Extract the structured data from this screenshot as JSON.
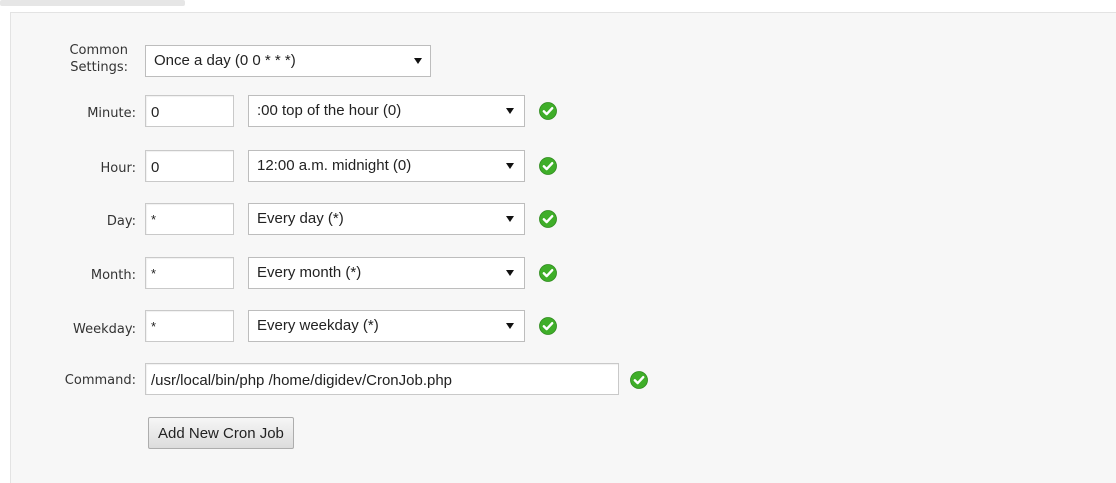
{
  "form": {
    "common_settings": {
      "label": "Common Settings:",
      "selected": "Once a day (0 0 * * *)"
    },
    "rows": [
      {
        "label": "Minute:",
        "value": "0",
        "select": ":00 top of the hour (0)",
        "valid": true
      },
      {
        "label": "Hour:",
        "value": "0",
        "select": "12:00 a.m. midnight (0)",
        "valid": true
      },
      {
        "label": "Day:",
        "value": "*",
        "select": "Every day (*)",
        "valid": true
      },
      {
        "label": "Month:",
        "value": "*",
        "select": "Every month (*)",
        "valid": true
      },
      {
        "label": "Weekday:",
        "value": "*",
        "select": "Every weekday (*)",
        "valid": true
      }
    ],
    "command": {
      "label": "Command:",
      "value": "/usr/local/bin/php /home/digidev/CronJob.php",
      "valid": true
    },
    "submit_label": "Add New Cron Job"
  },
  "icons": {
    "valid": "check-circle-icon"
  },
  "colors": {
    "panel_bg": "#f7f7f7",
    "check_green": "#3fae29",
    "check_green_dark": "#2d8a1c",
    "label_text": "#333333"
  }
}
